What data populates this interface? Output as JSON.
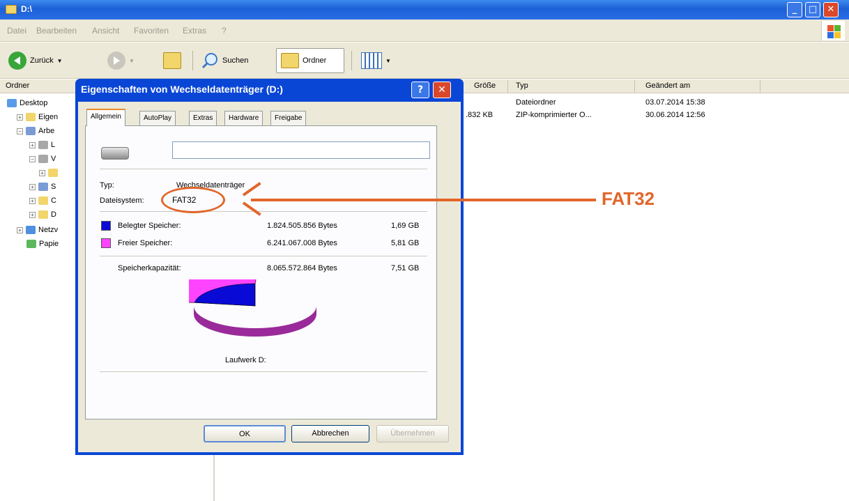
{
  "window": {
    "title": "D:\\"
  },
  "menu": [
    "Datei",
    "Bearbeiten",
    "Ansicht",
    "Favoriten",
    "Extras",
    "?"
  ],
  "toolbar": {
    "back_label": "Zurück",
    "search_label": "Suchen",
    "folders_label": "Ordner"
  },
  "columns": {
    "folders_pane": "Ordner",
    "size": "Größe",
    "type": "Typ",
    "modified": "Geändert am"
  },
  "tree": [
    {
      "label": "Desktop",
      "indent": 0,
      "expander": ""
    },
    {
      "label": "Eigen",
      "indent": 1,
      "expander": "+"
    },
    {
      "label": "Arbe",
      "indent": 1,
      "expander": "−"
    },
    {
      "label": "L",
      "indent": 2,
      "expander": "+"
    },
    {
      "label": "V",
      "indent": 2,
      "expander": "−"
    },
    {
      "label": "",
      "indent": 3,
      "expander": "+"
    },
    {
      "label": "S",
      "indent": 2,
      "expander": "+"
    },
    {
      "label": "C",
      "indent": 2,
      "expander": "+"
    },
    {
      "label": "D",
      "indent": 2,
      "expander": "+"
    },
    {
      "label": "Netzv",
      "indent": 1,
      "expander": "+"
    },
    {
      "label": "Papie",
      "indent": 1,
      "expander": ""
    }
  ],
  "files": [
    {
      "size": "",
      "type": "Dateiordner",
      "modified": "03.07.2014 15:38"
    },
    {
      "size": ".832 KB",
      "type": "ZIP-komprimierter O...",
      "modified": "30.06.2014 12:56"
    }
  ],
  "dialog": {
    "title": "Eigenschaften von Wechseldatenträger (D:)",
    "help_label": "?",
    "close_label": "✕",
    "tabs": [
      "Allgemein",
      "AutoPlay",
      "Extras",
      "Hardware",
      "Freigabe"
    ],
    "name_value": "",
    "type_label": "Typ:",
    "type_value": "Wechseldatenträger",
    "fs_label": "Dateisystem:",
    "fs_value": "FAT32",
    "used_label": "Belegter Speicher:",
    "used_bytes": "1.824.505.856 Bytes",
    "used_gb": "1,69 GB",
    "free_label": "Freier Speicher:",
    "free_bytes": "6.241.067.008 Bytes",
    "free_gb": "5,81 GB",
    "capacity_label": "Speicherkapazität:",
    "capacity_bytes": "8.065.572.864 Bytes",
    "capacity_gb": "7,51 GB",
    "drive_label": "Laufwerk D:",
    "ok_label": "OK",
    "cancel_label": "Abbrechen",
    "apply_label": "Übernehmen",
    "used_fraction": 0.226,
    "colors": {
      "used": "#0a0ad6",
      "free": "#ff44ff",
      "free_side": "#9a2a9a",
      "used_side": "#00007a"
    }
  },
  "annotation": {
    "label": "FAT32",
    "color": "#e1662a"
  }
}
